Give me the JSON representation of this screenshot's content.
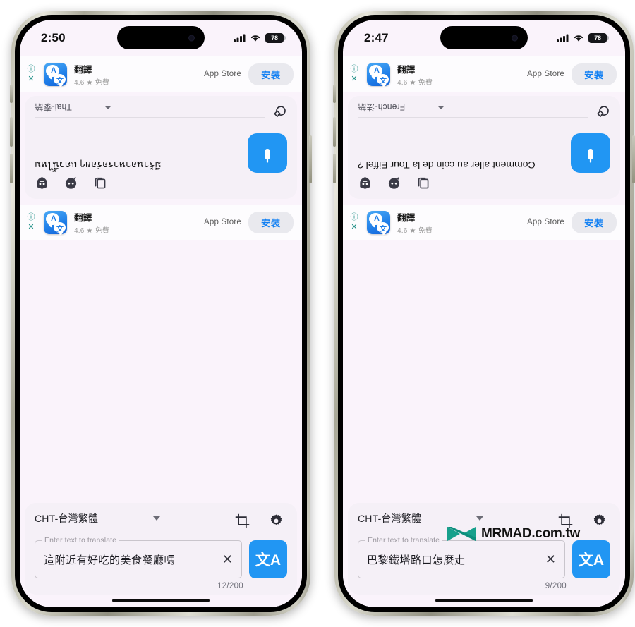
{
  "page": {
    "watermark": "MRMAD.com.tw",
    "background_color": "#ffffff"
  },
  "phones": [
    {
      "id": "left",
      "status_bar": {
        "time": "2:50",
        "cellular_icon": "signal-bars-icon",
        "wifi_icon": "wifi-icon",
        "battery_level": "78"
      },
      "ad_banner_top": {
        "info_icon": "info-icon",
        "close_icon": "close-icon",
        "app_icon": "translate-app-icon",
        "app_icon_letters": {
          "primary": "A",
          "secondary": "文"
        },
        "app_name": "翻譯",
        "rating": "4.6",
        "star_icon": "star-icon",
        "price": "免費",
        "store": "App Store",
        "install_label": "安裝"
      },
      "translation_card": {
        "rotated": "180",
        "toolbar_icons": [
          "copy-icon",
          "speech-face-icon",
          "shield-face-icon"
        ],
        "mic_icon": "microphone-icon",
        "translated_text": "มีร้านอาหารอร่อยๆ แถวนี้ไหม",
        "swap_icon": "swap-language-icon",
        "expand_icon": "chevron-up-icon",
        "language_label": "Thai-泰語"
      },
      "ad_banner_bottom": {
        "info_icon": "info-icon",
        "close_icon": "close-icon",
        "app_icon": "translate-app-icon",
        "app_name": "翻譯",
        "rating": "4.6",
        "price": "免費",
        "store": "App Store",
        "install_label": "安裝"
      },
      "bottom_panel": {
        "source_language": "CHT-台灣繁體",
        "dropdown_icon": "chevron-down-icon",
        "crop_icon": "crop-icon",
        "settings_icon": "gear-icon",
        "input_legend": "Enter text to translate",
        "input_value": "這附近有好吃的美食餐廳嗎",
        "clear_icon": "close-icon",
        "translate_button_label": "文A",
        "char_counter": "12/200"
      }
    },
    {
      "id": "right",
      "status_bar": {
        "time": "2:47",
        "cellular_icon": "signal-bars-icon",
        "wifi_icon": "wifi-icon",
        "battery_level": "78"
      },
      "ad_banner_top": {
        "info_icon": "info-icon",
        "close_icon": "close-icon",
        "app_icon": "translate-app-icon",
        "app_icon_letters": {
          "primary": "A",
          "secondary": "文"
        },
        "app_name": "翻譯",
        "rating": "4.6",
        "star_icon": "star-icon",
        "price": "免費",
        "store": "App Store",
        "install_label": "安裝"
      },
      "translation_card": {
        "rotated": "180",
        "toolbar_icons": [
          "copy-icon",
          "speech-face-icon",
          "shield-face-icon"
        ],
        "mic_icon": "microphone-icon",
        "translated_text": "Comment aller au coin de la Tour Eiffel ?",
        "swap_icon": "swap-language-icon",
        "expand_icon": "chevron-up-icon",
        "language_label": "French-法語"
      },
      "ad_banner_bottom": {
        "info_icon": "info-icon",
        "close_icon": "close-icon",
        "app_icon": "translate-app-icon",
        "app_name": "翻譯",
        "rating": "4.6",
        "price": "免費",
        "store": "App Store",
        "install_label": "安裝"
      },
      "bottom_panel": {
        "source_language": "CHT-台灣繁體",
        "dropdown_icon": "chevron-down-icon",
        "crop_icon": "crop-icon",
        "settings_icon": "gear-icon",
        "input_legend": "Enter text to translate",
        "input_value": "巴黎鐵塔路口怎麼走",
        "clear_icon": "close-icon",
        "translate_button_label": "文A",
        "char_counter": "9/200"
      }
    }
  ],
  "colors": {
    "accent_blue": "#2196f3",
    "install_text": "#1280f3",
    "screen_bg": "#faf3fb",
    "card_bg": "#f5f0f7",
    "ad_bg": "#fdfcfe",
    "ad_icon_teal": "#1f8f86",
    "watermark_teal": "#17a08c"
  }
}
